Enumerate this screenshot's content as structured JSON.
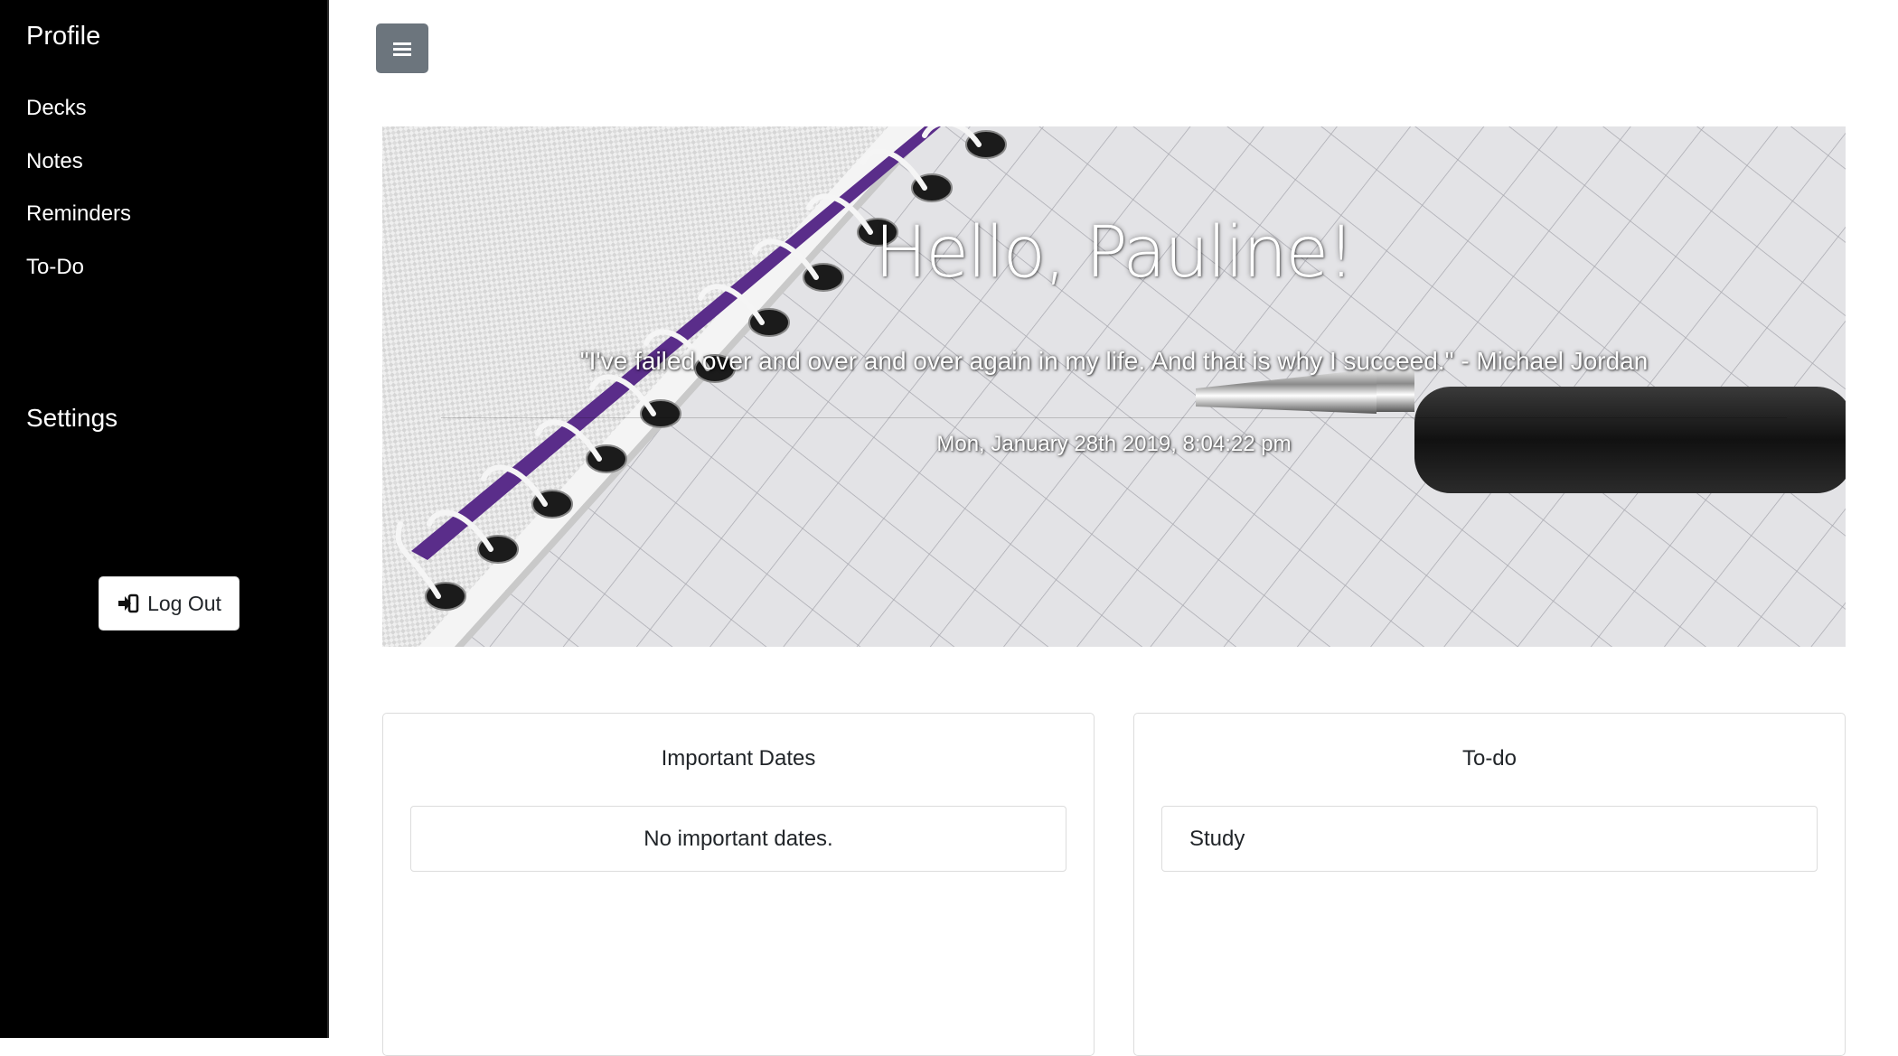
{
  "sidebar": {
    "brand": "Profile",
    "items": [
      {
        "label": "Decks"
      },
      {
        "label": "Notes"
      },
      {
        "label": "Reminders"
      },
      {
        "label": "To-Do"
      }
    ],
    "settings_label": "Settings",
    "logout_label": "Log Out"
  },
  "hero": {
    "greeting": "Hello, Pauline!",
    "quote": "\"I've failed over and over and over again in my life. And that is why I succeed.\" - Michael Jordan",
    "datetime": "Mon, January 28th 2019, 8:04:22 pm"
  },
  "cards": {
    "important_dates": {
      "title": "Important Dates",
      "empty_text": "No important dates."
    },
    "todo": {
      "title": "To-do",
      "items": [
        "Study"
      ]
    }
  },
  "colors": {
    "sidebar_bg": "#000000",
    "toggle_bg": "#6c757d",
    "text": "#212529"
  },
  "icons": {
    "toggle": "hamburger-icon",
    "logout": "sign-out-icon"
  }
}
